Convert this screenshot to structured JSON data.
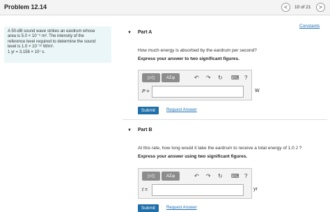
{
  "header": {
    "title": "Problem 12.14",
    "counter": "10 of 21",
    "prev_icon": "<",
    "next_icon": ">"
  },
  "constants_link": "Constants",
  "intro": {
    "line1": "A 50-dB sound wave strikes an eardrum whose",
    "line2": "area is 5.0 × 10⁻⁵ m². The intensity of the",
    "line3": "reference level required to determine the sound",
    "line4": "level is 1.0 × 10⁻¹² W/m².",
    "line5": "1 yr = 3.156 × 10⁷ s."
  },
  "part_a": {
    "caret": "▼",
    "title": "Part A",
    "question": "How much energy is absorbed by the eardrum per second?",
    "instruction": "Express your answer to two significant figures.",
    "toolbar": {
      "templates": "▯√▯",
      "symbols": "ΑΣφ",
      "undo": "↶",
      "redo": "↷",
      "reset": "↻",
      "keyboard": "⌨",
      "help": "?"
    },
    "variable": "P =",
    "unit": "W",
    "submit": "Submit",
    "request": "Request Answer"
  },
  "part_b": {
    "caret": "▼",
    "title": "Part B",
    "question": "At this rate, how long would it take the eardrum to receive a total energy of 1.0 J ?",
    "instruction": "Express your answer using two significant figures.",
    "toolbar": {
      "templates": "▯√▯",
      "symbols": "ΑΣφ",
      "undo": "↶",
      "redo": "↷",
      "reset": "↻",
      "keyboard": "⌨",
      "help": "?"
    },
    "variable": "t =",
    "unit": "yr",
    "submit": "Submit",
    "request": "Request Answer"
  }
}
